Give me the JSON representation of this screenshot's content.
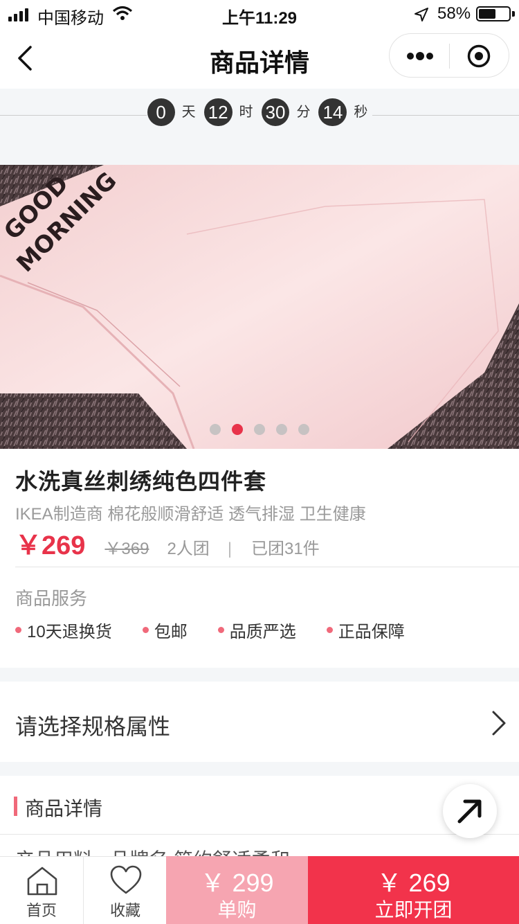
{
  "status_bar": {
    "carrier": "中国移动",
    "time": "上午11:29",
    "battery": "58%",
    "battery_level": 0.58,
    "icons": [
      "signal-icon",
      "wifi-icon",
      "location-arrow-icon",
      "battery-icon"
    ]
  },
  "nav": {
    "title": "商品详情",
    "icons": [
      "back-arrow-icon",
      "more-dots-icon",
      "close-target-icon"
    ]
  },
  "countdown": {
    "days": "0",
    "days_unit": "天",
    "hours": "12",
    "hours_unit": "时",
    "minutes": "30",
    "minutes_unit": "分",
    "seconds": "14",
    "seconds_unit": "秒"
  },
  "banner": {
    "embroidery_line1": "GOOD",
    "embroidery_line2": "MORNING",
    "slide_count": 5,
    "active_slide": 2
  },
  "product": {
    "title": "水洗真丝刺绣纯色四件套",
    "subtitle": "IKEA制造商 棉花般顺滑舒适 透气排湿 卫生健康",
    "price": "￥269",
    "original_price": "￥369",
    "group_size": "2人团",
    "separator": "|",
    "group_count": "已团31件"
  },
  "services": {
    "title": "商品服务",
    "items": [
      "10天退换货",
      "包邮",
      "品质严选",
      "正品保障"
    ]
  },
  "spec": {
    "label": "请选择规格属性",
    "icon": "chevron-right-icon"
  },
  "details": {
    "title": "商品详情",
    "peek_text": "产品用料 • 品牌名 简约舒适柔和"
  },
  "bottom_bar": {
    "home_label": "首页",
    "favorite_label": "收藏",
    "single_price": "￥ 299",
    "single_label": "单购",
    "group_price": "￥ 269",
    "group_label": "立即开团",
    "single_color": "#f6a5b1",
    "group_color": "#f2334b"
  },
  "colors": {
    "accent": "#e8334a",
    "bullet": "#f0697a"
  }
}
